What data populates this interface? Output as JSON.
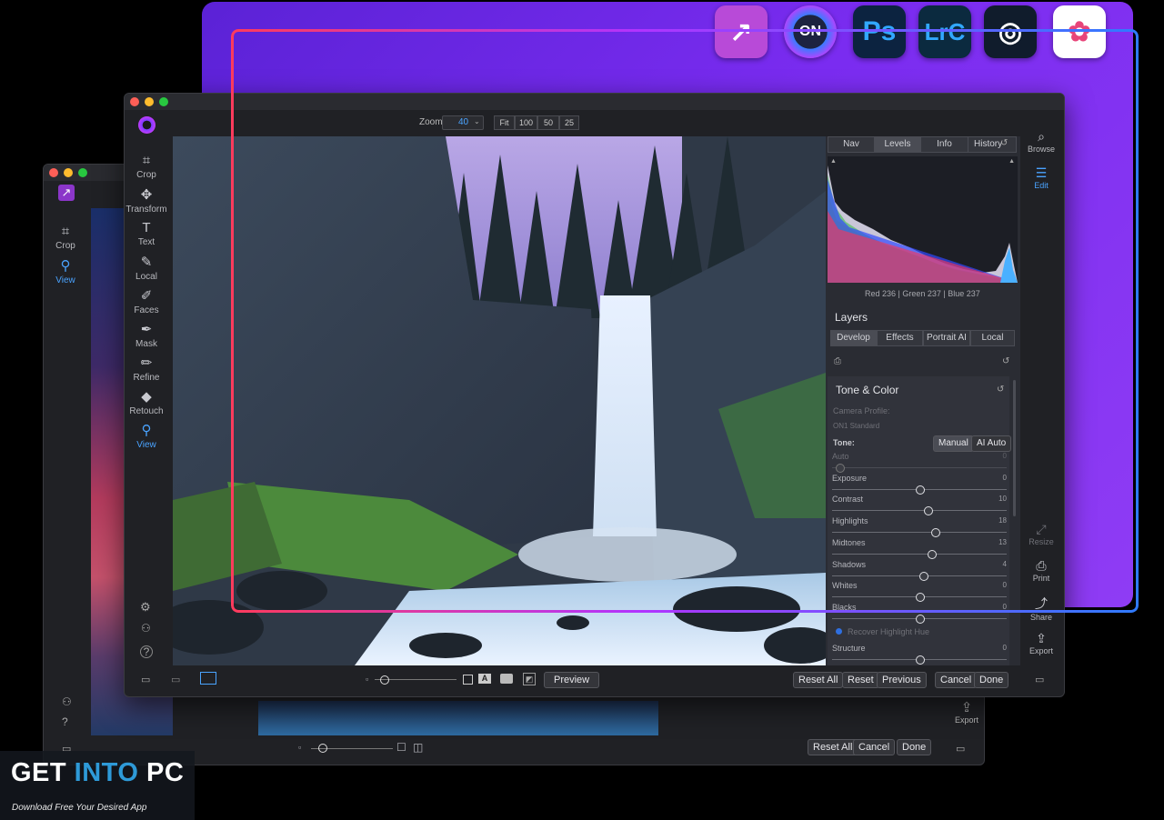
{
  "apps": {
    "icons": [
      {
        "name": "on1-resize-icon",
        "label": "↗",
        "bg": "#b84ad8"
      },
      {
        "name": "on1-photo-raw-icon",
        "label": "ON",
        "bg": "#2a2f5a"
      },
      {
        "name": "photoshop-icon",
        "label": "Ps",
        "bg": "#0c2340"
      },
      {
        "name": "lightroom-classic-icon",
        "label": "LrC",
        "bg": "#0b2a3f"
      },
      {
        "name": "photoshop-elements-icon",
        "label": "◎",
        "bg": "#101c2c"
      },
      {
        "name": "apple-photos-icon",
        "label": "✿",
        "bg": "#ffffff"
      }
    ]
  },
  "front": {
    "zoom_label": "Zoom",
    "zoom_value": "40",
    "zoom_presets": [
      "Fit",
      "100",
      "50",
      "25"
    ],
    "tools": [
      {
        "label": "Crop",
        "icon": "⌗",
        "name": "crop"
      },
      {
        "label": "Transform",
        "icon": "✥",
        "name": "transform"
      },
      {
        "label": "Text",
        "icon": "T",
        "name": "text"
      },
      {
        "label": "Local",
        "icon": "✎",
        "name": "local"
      },
      {
        "label": "Faces",
        "icon": "✐",
        "name": "faces"
      },
      {
        "label": "Mask",
        "icon": "✒",
        "name": "mask"
      },
      {
        "label": "Refine",
        "icon": "✏",
        "name": "refine"
      },
      {
        "label": "Retouch",
        "icon": "◆",
        "name": "retouch"
      },
      {
        "label": "View",
        "icon": "⚲",
        "name": "view"
      }
    ],
    "right_tools": [
      {
        "label": "Browse",
        "icon": "⌕",
        "name": "browse"
      },
      {
        "label": "Edit",
        "icon": "☰",
        "name": "edit"
      },
      {
        "label": "Resize",
        "icon": "⤢",
        "name": "resize"
      },
      {
        "label": "Print",
        "icon": "⎙",
        "name": "print"
      },
      {
        "label": "Share",
        "icon": "⤴",
        "name": "share"
      },
      {
        "label": "Export",
        "icon": "⇪",
        "name": "export"
      }
    ],
    "panel_tabs": [
      "Nav",
      "Levels",
      "Info",
      "History"
    ],
    "histogram_readout": "Red 236 | Green 237 | Blue 237",
    "layers_title": "Layers",
    "module_tabs": [
      "Develop",
      "Effects",
      "Portrait AI",
      "Local"
    ],
    "tone_title": "Tone & Color",
    "camera_profile_label": "Camera Profile:",
    "camera_profile_value": "ON1 Standard",
    "tone_label": "Tone:",
    "tone_modes": [
      "Manual",
      "AI Auto"
    ],
    "sliders": [
      {
        "label": "Auto",
        "value": "0",
        "pos": 0.02,
        "dim": true
      },
      {
        "label": "Exposure",
        "value": "0",
        "pos": 0.5
      },
      {
        "label": "Contrast",
        "value": "10",
        "pos": 0.55
      },
      {
        "label": "Highlights",
        "value": "18",
        "pos": 0.59
      },
      {
        "label": "Midtones",
        "value": "13",
        "pos": 0.57
      },
      {
        "label": "Shadows",
        "value": "4",
        "pos": 0.52
      },
      {
        "label": "Whites",
        "value": "0",
        "pos": 0.5
      },
      {
        "label": "Blacks",
        "value": "0",
        "pos": 0.5
      }
    ],
    "recover_label": "Recover Highlight Hue",
    "structure": {
      "label": "Structure",
      "value": "0",
      "pos": 0.5
    },
    "bottom_buttons": [
      "Preview",
      "Reset All",
      "Reset",
      "Previous",
      "Cancel",
      "Done"
    ]
  },
  "middle": {
    "tools": [
      {
        "label": "Crop",
        "icon": "⌗",
        "name": "crop"
      },
      {
        "label": "View",
        "icon": "⚲",
        "name": "view"
      }
    ],
    "export_label": "Export",
    "bottom_buttons": [
      "Reset All",
      "Cancel",
      "Done"
    ]
  },
  "watermark": {
    "title_a": "GET ",
    "title_b": "INTO",
    "title_c": " PC",
    "subtitle": "Download Free Your Desired App"
  }
}
